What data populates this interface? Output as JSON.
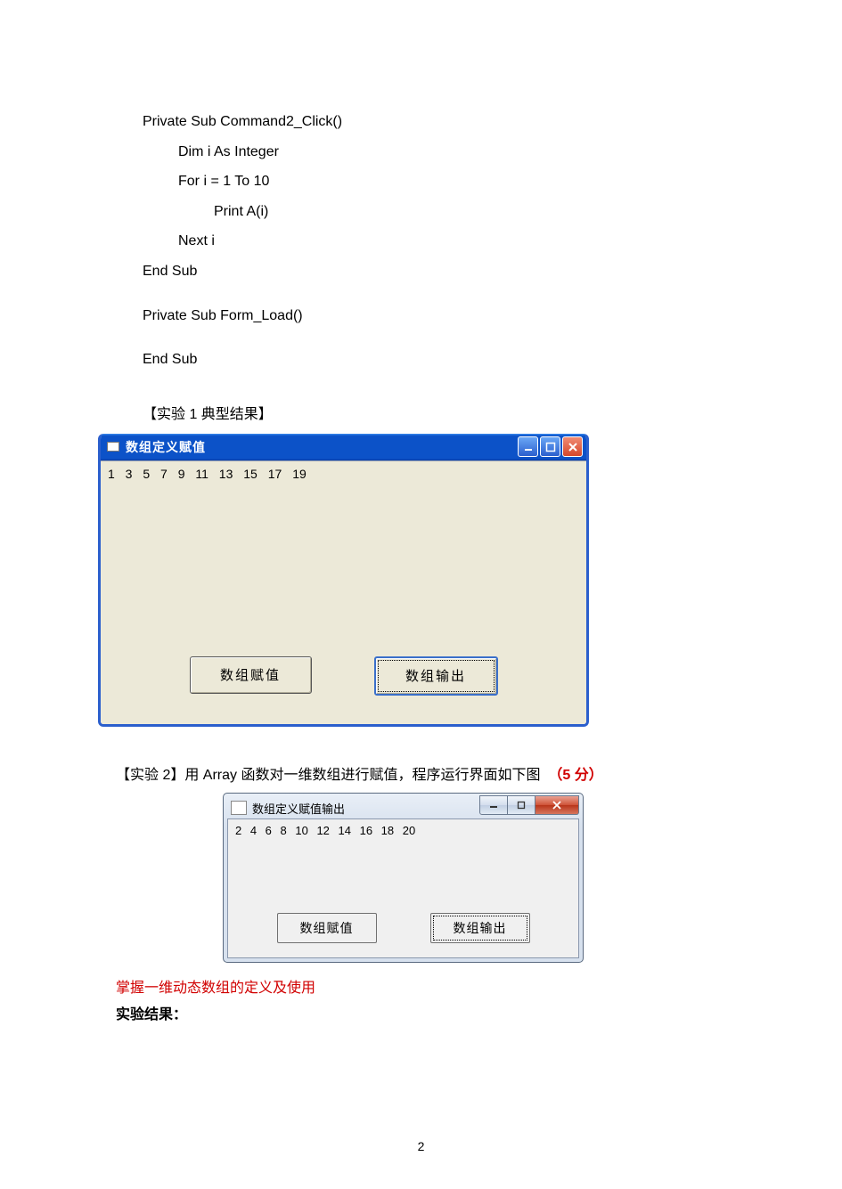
{
  "code": {
    "l1": "Private Sub Command2_Click()",
    "l2": "Dim i As Integer",
    "l3": "For i = 1 To 10",
    "l4": "Print A(i)",
    "l5": "Next i",
    "l6": "End Sub",
    "l7": "Private Sub Form_Load()",
    "l8": "End Sub"
  },
  "section1_label": "【实验 1 典型结果】",
  "winxp": {
    "title": "数组定义赋值",
    "output": "1 3 5 7 9 11 13 15 17 19",
    "btn_assign": "数组赋值",
    "btn_output": "数组输出"
  },
  "caption2": {
    "prefix": "【实验 2】用 Array 函数对一维数组进行赋值，程序运行界面如下图",
    "score": "（5 分）"
  },
  "win7": {
    "title": "数组定义赋值输出",
    "output": "2 4 6 8 10 12 14 16 18 20",
    "btn_assign": "数组赋值",
    "btn_output": "数组输出"
  },
  "red_note": "掌握一维动态数组的定义及使用",
  "result_label": "实验结果：",
  "page_number": "2"
}
